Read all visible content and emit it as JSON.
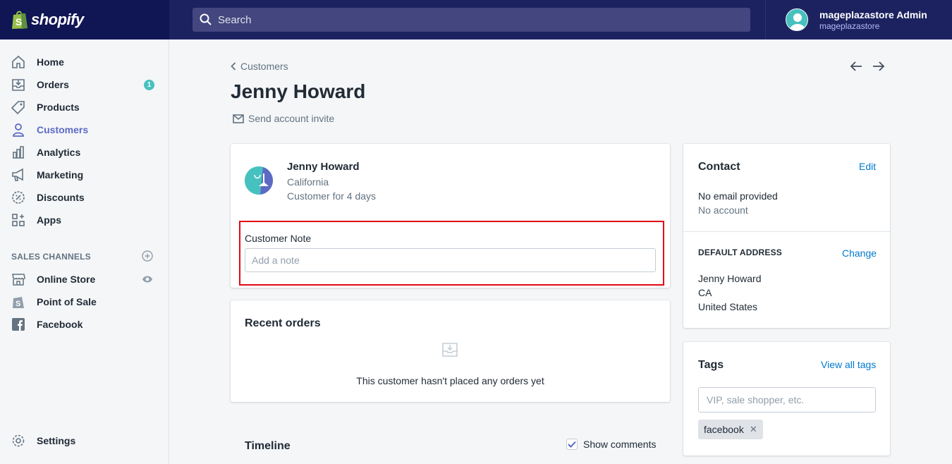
{
  "topbar": {
    "brand": "shopify",
    "search_placeholder": "Search",
    "user_name": "mageplazastore Admin",
    "user_store": "mageplazastore"
  },
  "sidebar": {
    "items": [
      {
        "label": "Home",
        "icon": "home-icon"
      },
      {
        "label": "Orders",
        "icon": "orders-icon",
        "badge": "1"
      },
      {
        "label": "Products",
        "icon": "tag-icon"
      },
      {
        "label": "Customers",
        "icon": "person-icon",
        "active": true
      },
      {
        "label": "Analytics",
        "icon": "bar-chart-icon"
      },
      {
        "label": "Marketing",
        "icon": "megaphone-icon"
      },
      {
        "label": "Discounts",
        "icon": "discount-icon"
      },
      {
        "label": "Apps",
        "icon": "apps-icon"
      }
    ],
    "sales_channels_title": "SALES CHANNELS",
    "channels": [
      {
        "label": "Online Store",
        "icon": "store-icon"
      },
      {
        "label": "Point of Sale",
        "icon": "shopify-bag-icon"
      },
      {
        "label": "Facebook",
        "icon": "facebook-icon"
      }
    ],
    "settings_label": "Settings"
  },
  "page": {
    "breadcrumb": "Customers",
    "title": "Jenny Howard",
    "invite_label": "Send account invite"
  },
  "customer": {
    "name": "Jenny Howard",
    "location": "California",
    "since": "Customer for 4 days",
    "note_label": "Customer Note",
    "note_placeholder": "Add a note"
  },
  "recent_orders": {
    "title": "Recent orders",
    "empty_text": "This customer hasn't placed any orders yet"
  },
  "timeline": {
    "title": "Timeline",
    "show_comments_label": "Show comments",
    "show_comments_checked": true
  },
  "contact": {
    "title": "Contact",
    "edit_label": "Edit",
    "email": "No email provided",
    "account": "No account",
    "address_title": "DEFAULT ADDRESS",
    "change_label": "Change",
    "address_lines": [
      "Jenny Howard",
      "CA",
      "United States"
    ]
  },
  "tags": {
    "title": "Tags",
    "view_all_label": "View all tags",
    "input_placeholder": "VIP, sale shopper, etc.",
    "items": [
      "facebook"
    ]
  },
  "colors": {
    "topbar": "#1c2260",
    "accent": "#5c6ac4",
    "link": "#007ace",
    "highlight_box": "#e30613",
    "badge": "#47c1bf"
  }
}
